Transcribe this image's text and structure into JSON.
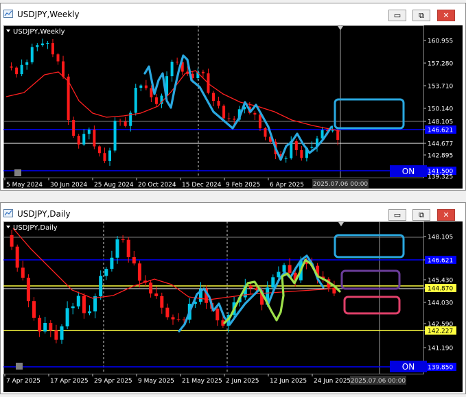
{
  "weekly": {
    "window_title": "USDJPY,Weekly",
    "chart_label": "USDJPY,Weekly",
    "price_labels": [
      "160.955",
      "157.280",
      "153.710",
      "150.140",
      "148.105",
      "146.621",
      "144.677",
      "142.895",
      "141.500",
      "139.325"
    ],
    "date_labels": [
      "5 May 2024",
      "30 Jun 2024",
      "25 Aug 2024",
      "20 Oct 2024",
      "15 Dec 2024",
      "9 Feb 2025",
      "6 Apr 2025"
    ],
    "cursor_date": "2025.07.06 00:00",
    "on_label": "ON"
  },
  "daily": {
    "window_title": "USDJPY,Daily",
    "chart_label": "USDJPY,Daily",
    "price_labels": [
      "148.105",
      "146.621",
      "145.430",
      "144.870",
      "144.030",
      "142.590",
      "142.227",
      "141.190",
      "139.850"
    ],
    "date_labels": [
      "7 Apr 2025",
      "17 Apr 2025",
      "29 Apr 2025",
      "9 May 2025",
      "21 May 2025",
      "2 Jun 2025",
      "12 Jun 2025",
      "24 Jun 2025"
    ],
    "cursor_date": "2025.07.06 00:00",
    "on_label": "ON"
  },
  "colors": {
    "bull": "#00c8e8",
    "bear": "#ff1a1a",
    "ma": "#ff2020",
    "support_blue": "#0000ff",
    "yellow": "#ffff40",
    "trend_blue": "#2aa8e0",
    "trend_green": "#9ee04a",
    "box_blue": "#2aa8e0",
    "box_purple": "#6b3d9a",
    "box_pink": "#e0406a"
  },
  "buttons": {
    "minimize": "▭",
    "restore": "⧉",
    "close": "✕"
  }
}
